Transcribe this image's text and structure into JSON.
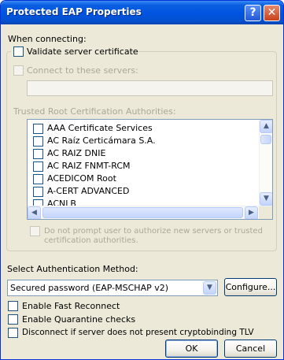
{
  "window": {
    "title": "Protected EAP Properties",
    "help_label": "?",
    "close_label": "✕"
  },
  "when_connecting": {
    "label": "When connecting:",
    "validate_server_certificate": {
      "label": "Validate server certificate",
      "checked": false
    },
    "connect_to_servers": {
      "label": "Connect to these servers:",
      "checked": false,
      "enabled": false,
      "value": ""
    },
    "trusted_root_label": "Trusted Root Certification Authorities:",
    "trusted_roots": [
      {
        "name": "AAA Certificate Services",
        "checked": false
      },
      {
        "name": "AC Raíz Certicámara S.A.",
        "checked": false
      },
      {
        "name": "AC RAIZ DNIE",
        "checked": false
      },
      {
        "name": "AC RAIZ FNMT-RCM",
        "checked": false
      },
      {
        "name": "ACEDICOM Root",
        "checked": false
      },
      {
        "name": "A-CERT ADVANCED",
        "checked": false
      },
      {
        "name": "ACNLB",
        "checked": false
      }
    ],
    "do_not_prompt": {
      "line1": "Do not prompt user to authorize new servers or trusted",
      "line2": "certification authorities.",
      "checked": false,
      "enabled": false
    }
  },
  "authentication": {
    "label": "Select Authentication Method:",
    "selected_method": "Secured password (EAP-MSCHAP v2)",
    "configure_label": "Configure..."
  },
  "options": {
    "enable_fast_reconnect": {
      "label": "Enable Fast Reconnect",
      "checked": false
    },
    "enable_quarantine_checks": {
      "label": "Enable Quarantine checks",
      "checked": false
    },
    "disconnect_cryptobinding": {
      "label": "Disconnect if server does not present cryptobinding TLV",
      "checked": false
    }
  },
  "footer": {
    "ok_label": "OK",
    "cancel_label": "Cancel"
  },
  "colors": {
    "titlebar": "#0053e0",
    "dialog_bg": "#ece9d8",
    "disabled_text": "#aca899"
  }
}
